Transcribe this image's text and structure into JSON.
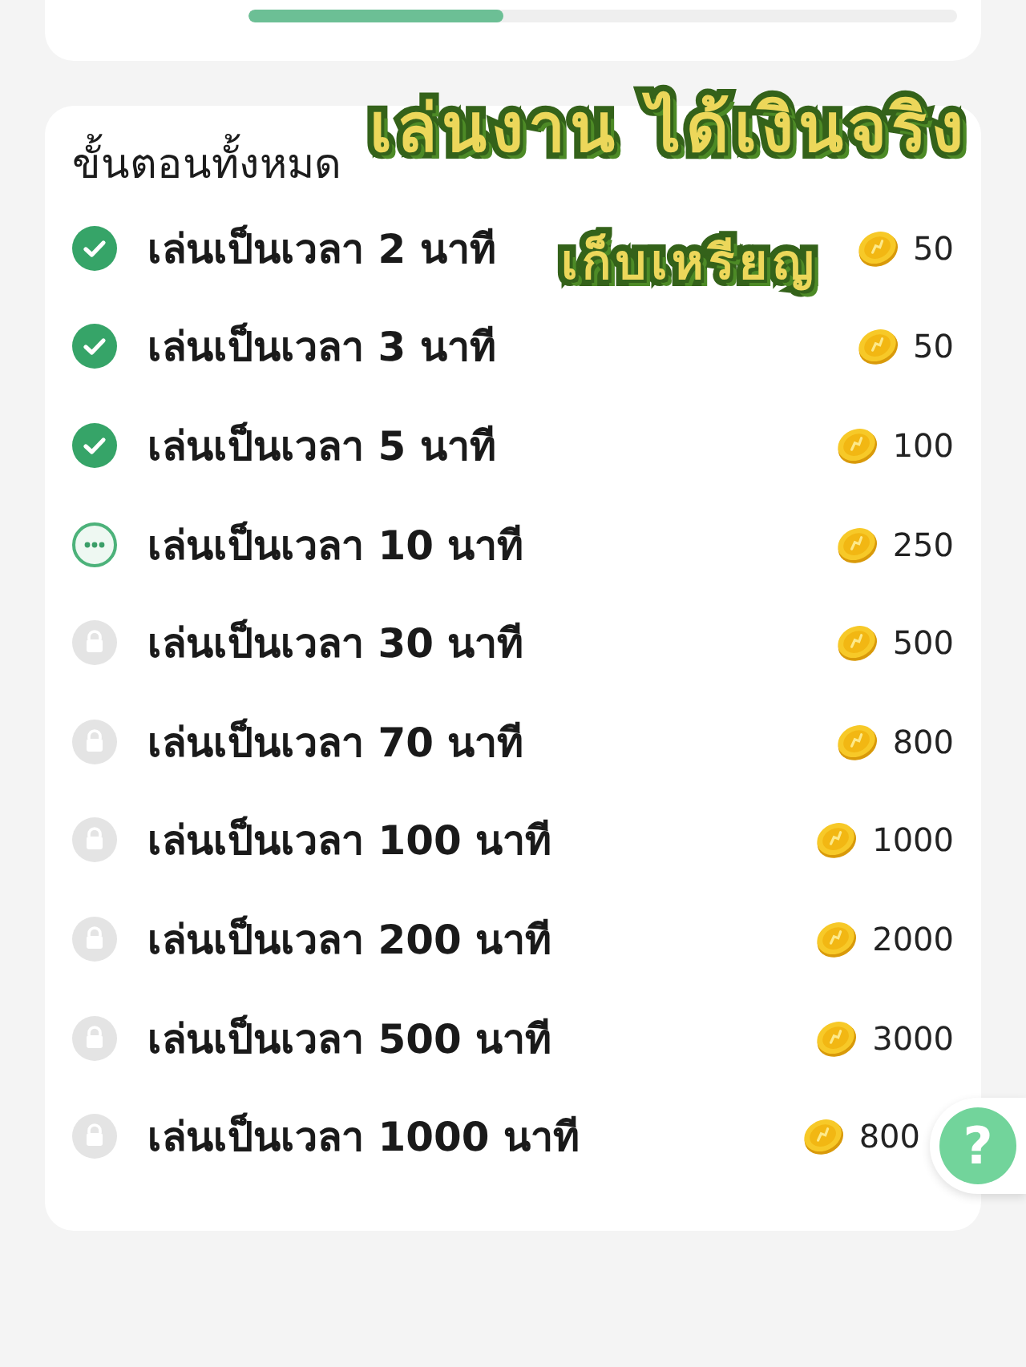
{
  "progress": {
    "level": 0.36
  },
  "steps_card": {
    "title": "ขั้นตอนทั้งหมด",
    "stickers": [
      {
        "text": "เล่นงาน ได้เงินจริง",
        "kind": "headline"
      },
      {
        "text": "เก็บเหรียญ",
        "kind": "caption"
      }
    ],
    "steps": [
      {
        "label": "เล่นเป็นเวลา 2 นาที",
        "completed": true,
        "locked": false,
        "reward": "50"
      },
      {
        "label": "เล่นเป็นเวลา 3 นาที",
        "completed": true,
        "locked": false,
        "reward": "50"
      },
      {
        "label": "เล่นเป็นเวลา 5 นาที",
        "completed": true,
        "locked": false,
        "reward": "100"
      },
      {
        "label": "เล่นเป็นเวลา 10 นาที",
        "completed": false,
        "locked": false,
        "reward": "250"
      },
      {
        "label": "เล่นเป็นเวลา 30 นาที",
        "completed": false,
        "locked": true,
        "reward": "500"
      },
      {
        "label": "เล่นเป็นเวลา 70 นาที",
        "completed": false,
        "locked": true,
        "reward": "800"
      },
      {
        "label": "เล่นเป็นเวลา 100 นาที",
        "completed": false,
        "locked": true,
        "reward": "1000"
      },
      {
        "label": "เล่นเป็นเวลา 200 นาที",
        "completed": false,
        "locked": true,
        "reward": "2000"
      },
      {
        "label": "เล่นเป็นเวลา 500 นาที",
        "completed": false,
        "locked": true,
        "reward": "3000"
      },
      {
        "label": "เล่นเป็นเวลา 1000 นาที",
        "completed": false,
        "locked": true,
        "reward": "800"
      }
    ]
  },
  "help_button": {
    "label": "?"
  }
}
